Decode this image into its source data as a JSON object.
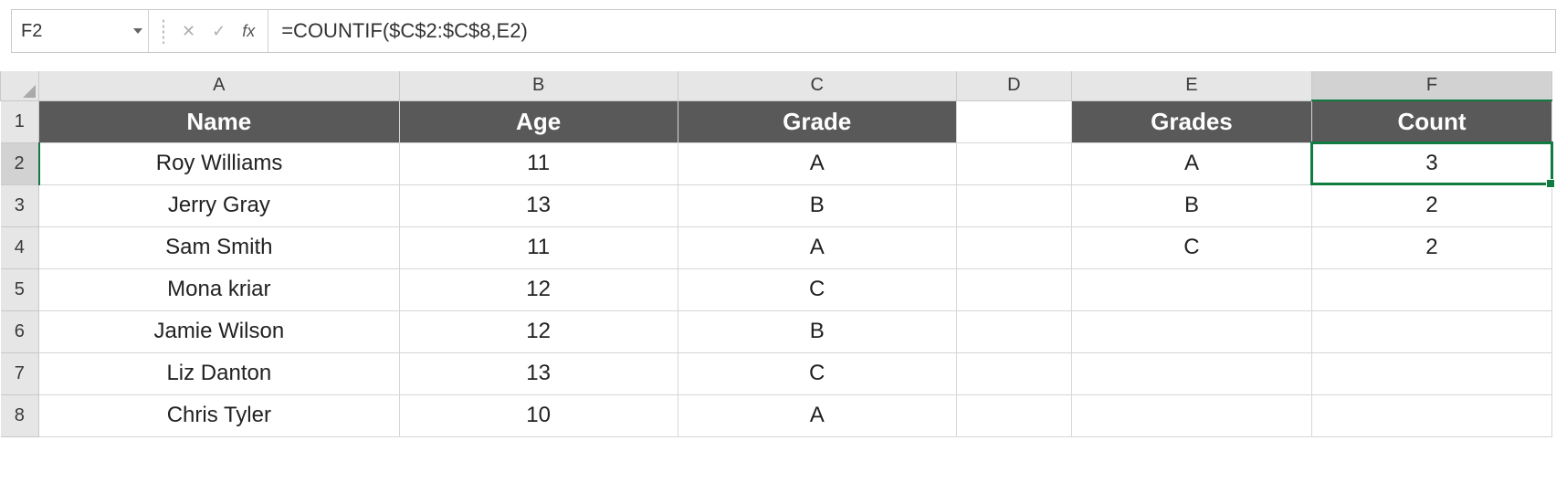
{
  "formula_bar": {
    "cell_ref": "F2",
    "cancel_icon": "✕",
    "accept_icon": "✓",
    "fx_label": "fx",
    "formula": "=COUNTIF($C$2:$C$8,E2)"
  },
  "columns": [
    "A",
    "B",
    "C",
    "D",
    "E",
    "F"
  ],
  "selected_column": "F",
  "selected_row": "2",
  "row_headers": [
    "1",
    "2",
    "3",
    "4",
    "5",
    "6",
    "7",
    "8"
  ],
  "header_row": {
    "A": "Name",
    "B": "Age",
    "C": "Grade",
    "D": "",
    "E": "Grades",
    "F": "Count"
  },
  "data_rows": [
    {
      "A": "Roy Williams",
      "B": "11",
      "C": "A",
      "D": "",
      "E": "A",
      "F": "3"
    },
    {
      "A": "Jerry Gray",
      "B": "13",
      "C": "B",
      "D": "",
      "E": "B",
      "F": "2"
    },
    {
      "A": "Sam Smith",
      "B": "11",
      "C": "A",
      "D": "",
      "E": "C",
      "F": "2"
    },
    {
      "A": "Mona kriar",
      "B": "12",
      "C": "C",
      "D": "",
      "E": "",
      "F": ""
    },
    {
      "A": "Jamie Wilson",
      "B": "12",
      "C": "B",
      "D": "",
      "E": "",
      "F": ""
    },
    {
      "A": "Liz Danton",
      "B": "13",
      "C": "C",
      "D": "",
      "E": "",
      "F": ""
    },
    {
      "A": "Chris Tyler",
      "B": "10",
      "C": "A",
      "D": "",
      "E": "",
      "F": ""
    }
  ]
}
